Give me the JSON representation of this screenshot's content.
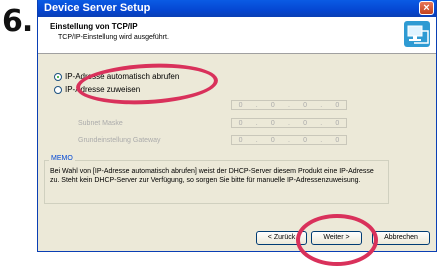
{
  "step": "6.",
  "window": {
    "title": "Device Server Setup",
    "close_glyph": "×"
  },
  "header": {
    "title": "Einstellung von TCP/IP",
    "subtitle": "TCP/IP-Einstellung wird ausgeführt.",
    "icon": "network-computer-icon"
  },
  "radios": {
    "auto_label": "IP-Adresse automatisch abrufen",
    "manual_label": "IP-Adresse zuweisen",
    "selected": "auto"
  },
  "fields": [
    {
      "label": "",
      "octets": [
        "0",
        "0",
        "0",
        "0"
      ]
    },
    {
      "label": "Subnet Maske",
      "octets": [
        "0",
        "0",
        "0",
        "0"
      ]
    },
    {
      "label": "Grundeinstellung Gateway",
      "octets": [
        "0",
        "0",
        "0",
        "0"
      ]
    }
  ],
  "memo": {
    "title": "MEMO",
    "text": "Bei Wahl von [IP-Adresse automatisch abrufen] weist der DHCP-Server diesem Produkt eine IP-Adresse zu. Steht kein DHCP-Server zur Verfügung, so sorgen Sie bitte für manuelle IP-Adressenzuweisung."
  },
  "buttons": {
    "back": "< Zurück",
    "next": "Weiter >",
    "cancel": "Abbrechen"
  },
  "colors": {
    "highlight_ring": "#d9315b",
    "titlebar": "#0546d2"
  }
}
